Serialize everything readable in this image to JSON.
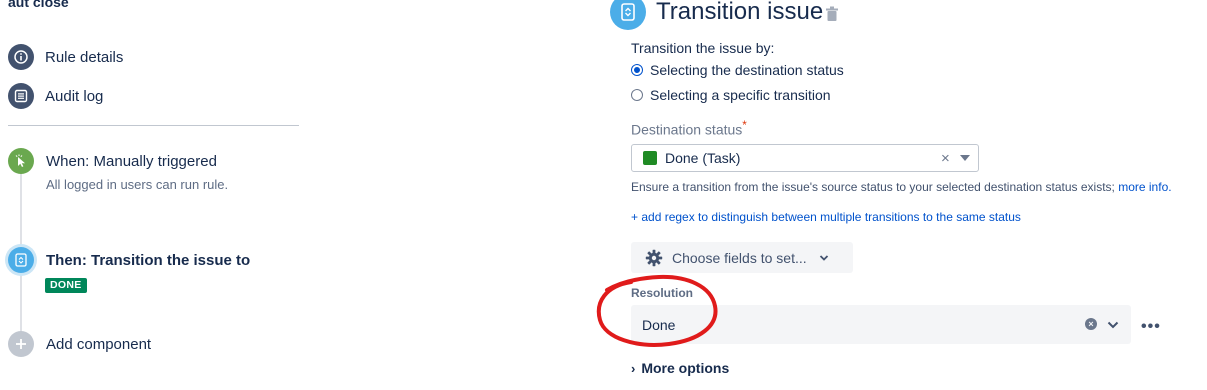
{
  "rule": {
    "title": "aut close"
  },
  "nav": {
    "items": [
      {
        "label": "Rule details",
        "icon": "info-icon"
      },
      {
        "label": "Audit log",
        "icon": "list-icon"
      }
    ]
  },
  "components": {
    "trigger": {
      "title": "When: Manually triggered",
      "subtitle": "All logged in users can run rule.",
      "icon": "cursor-click-icon",
      "color": "#6aa84f"
    },
    "action": {
      "title": "Then: Transition the issue to",
      "badge": "DONE",
      "icon": "transition-icon",
      "color": "#4bade8"
    },
    "add": {
      "label": "Add component",
      "icon": "plus-icon",
      "color": "#c1c7d0"
    }
  },
  "editor": {
    "title": "Transition issue",
    "transition_by_label": "Transition the issue by:",
    "radio_options": [
      {
        "label": "Selecting the destination status",
        "checked": true
      },
      {
        "label": "Selecting a specific transition",
        "checked": false
      }
    ],
    "destination_label": "Destination status",
    "required_mark": "*",
    "destination_value": "Done (Task)",
    "status_color": "#1f8b24",
    "help_text": "Ensure a transition from the issue's source status to your selected destination status exists;",
    "help_link": "more info.",
    "regex_link": "+ add regex to distinguish between multiple transitions to the same status",
    "choose_fields_label": "Choose fields to set...",
    "resolution_label": "Resolution",
    "resolution_value": "Done",
    "more_options": "More options"
  },
  "colors": {
    "accent": "#0052cc",
    "done_green": "#00875a",
    "annotation_red": "#e01b1b"
  }
}
